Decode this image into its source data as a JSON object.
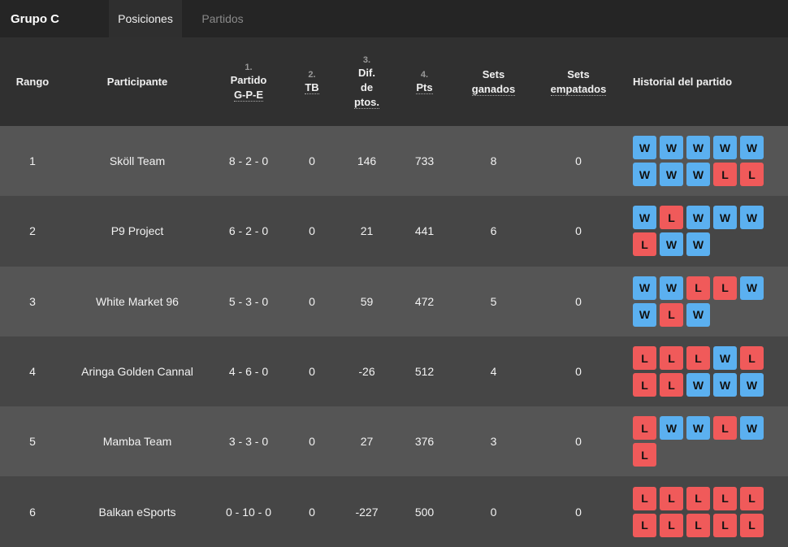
{
  "header": {
    "group_title": "Grupo C",
    "tabs": [
      {
        "label": "Posiciones",
        "active": true
      },
      {
        "label": "Partidos",
        "active": false
      }
    ]
  },
  "columns": {
    "rank": "Rango",
    "participant": "Participante",
    "match": {
      "num": "1.",
      "line1": "Partido",
      "line2": "G-P-E"
    },
    "tb": {
      "num": "2.",
      "label": "TB"
    },
    "diff": {
      "num": "3.",
      "line1": "Dif.",
      "line2": "de",
      "line3": "ptos."
    },
    "pts": {
      "num": "4.",
      "label": "Pts"
    },
    "sets_won": {
      "line1": "Sets",
      "line2": "ganados"
    },
    "sets_tied": {
      "line1": "Sets",
      "line2": "empatados"
    },
    "history": "Historial del partido"
  },
  "colors": {
    "win": "#5bb0f0",
    "loss": "#f05a5a"
  },
  "rows": [
    {
      "rank": "1",
      "name": "Sköll Team",
      "record": "8 - 2 - 0",
      "tb": "0",
      "diff": "146",
      "pts": "733",
      "sets_won": "8",
      "sets_tied": "0",
      "history": [
        "W",
        "W",
        "W",
        "W",
        "W",
        "W",
        "W",
        "W",
        "L",
        "L"
      ]
    },
    {
      "rank": "2",
      "name": "P9 Project",
      "record": "6 - 2 - 0",
      "tb": "0",
      "diff": "21",
      "pts": "441",
      "sets_won": "6",
      "sets_tied": "0",
      "history": [
        "W",
        "L",
        "W",
        "W",
        "W",
        "L",
        "W",
        "W"
      ]
    },
    {
      "rank": "3",
      "name": "White Market 96",
      "record": "5 - 3 - 0",
      "tb": "0",
      "diff": "59",
      "pts": "472",
      "sets_won": "5",
      "sets_tied": "0",
      "history": [
        "W",
        "W",
        "L",
        "L",
        "W",
        "W",
        "L",
        "W"
      ]
    },
    {
      "rank": "4",
      "name": "Aringa Golden Cannal",
      "record": "4 - 6 - 0",
      "tb": "0",
      "diff": "-26",
      "pts": "512",
      "sets_won": "4",
      "sets_tied": "0",
      "history": [
        "L",
        "L",
        "L",
        "W",
        "L",
        "L",
        "L",
        "W",
        "W",
        "W"
      ]
    },
    {
      "rank": "5",
      "name": "Mamba Team",
      "record": "3 - 3 - 0",
      "tb": "0",
      "diff": "27",
      "pts": "376",
      "sets_won": "3",
      "sets_tied": "0",
      "history": [
        "L",
        "W",
        "W",
        "L",
        "W",
        "L"
      ]
    },
    {
      "rank": "6",
      "name": "Balkan eSports",
      "record": "0 - 10 - 0",
      "tb": "0",
      "diff": "-227",
      "pts": "500",
      "sets_won": "0",
      "sets_tied": "0",
      "history": [
        "L",
        "L",
        "L",
        "L",
        "L",
        "L",
        "L",
        "L",
        "L",
        "L"
      ]
    }
  ]
}
